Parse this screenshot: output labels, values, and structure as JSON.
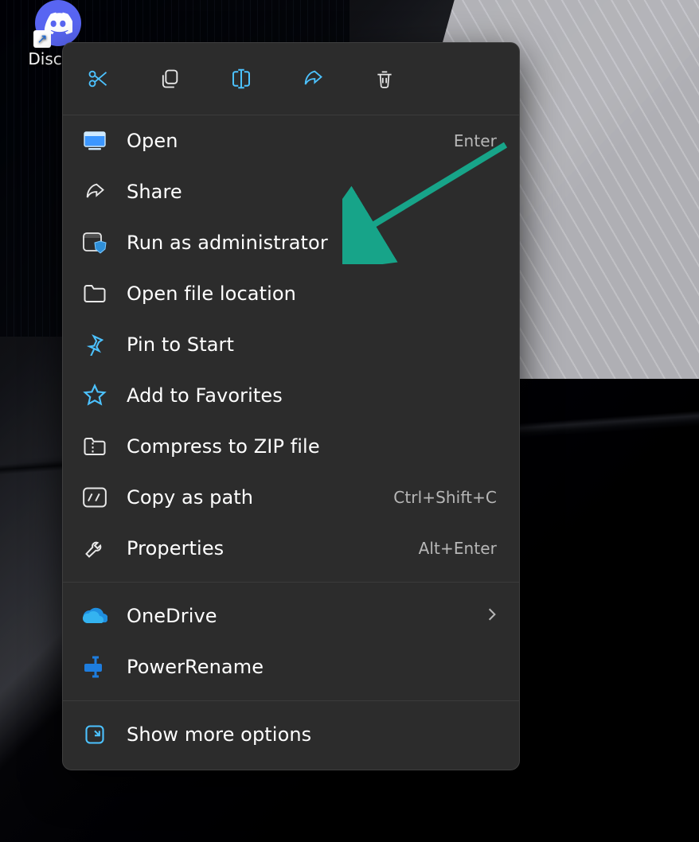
{
  "desktop": {
    "icon_label": "Discord"
  },
  "toolbar": {
    "cut": "Cut",
    "copy": "Copy",
    "rename": "Rename",
    "share": "Share",
    "delete": "Delete"
  },
  "menu": {
    "open": {
      "label": "Open",
      "shortcut": "Enter"
    },
    "share": {
      "label": "Share"
    },
    "runadmin": {
      "label": "Run as administrator"
    },
    "openloc": {
      "label": "Open file location"
    },
    "pinstart": {
      "label": "Pin to Start"
    },
    "addfav": {
      "label": "Add to Favorites"
    },
    "zip": {
      "label": "Compress to ZIP file"
    },
    "copypath": {
      "label": "Copy as path",
      "shortcut": "Ctrl+Shift+C"
    },
    "properties": {
      "label": "Properties",
      "shortcut": "Alt+Enter"
    },
    "onedrive": {
      "label": "OneDrive"
    },
    "powerrename": {
      "label": "PowerRename"
    },
    "more": {
      "label": "Show more options"
    }
  },
  "annotation": {
    "arrow_color": "#17a489"
  }
}
